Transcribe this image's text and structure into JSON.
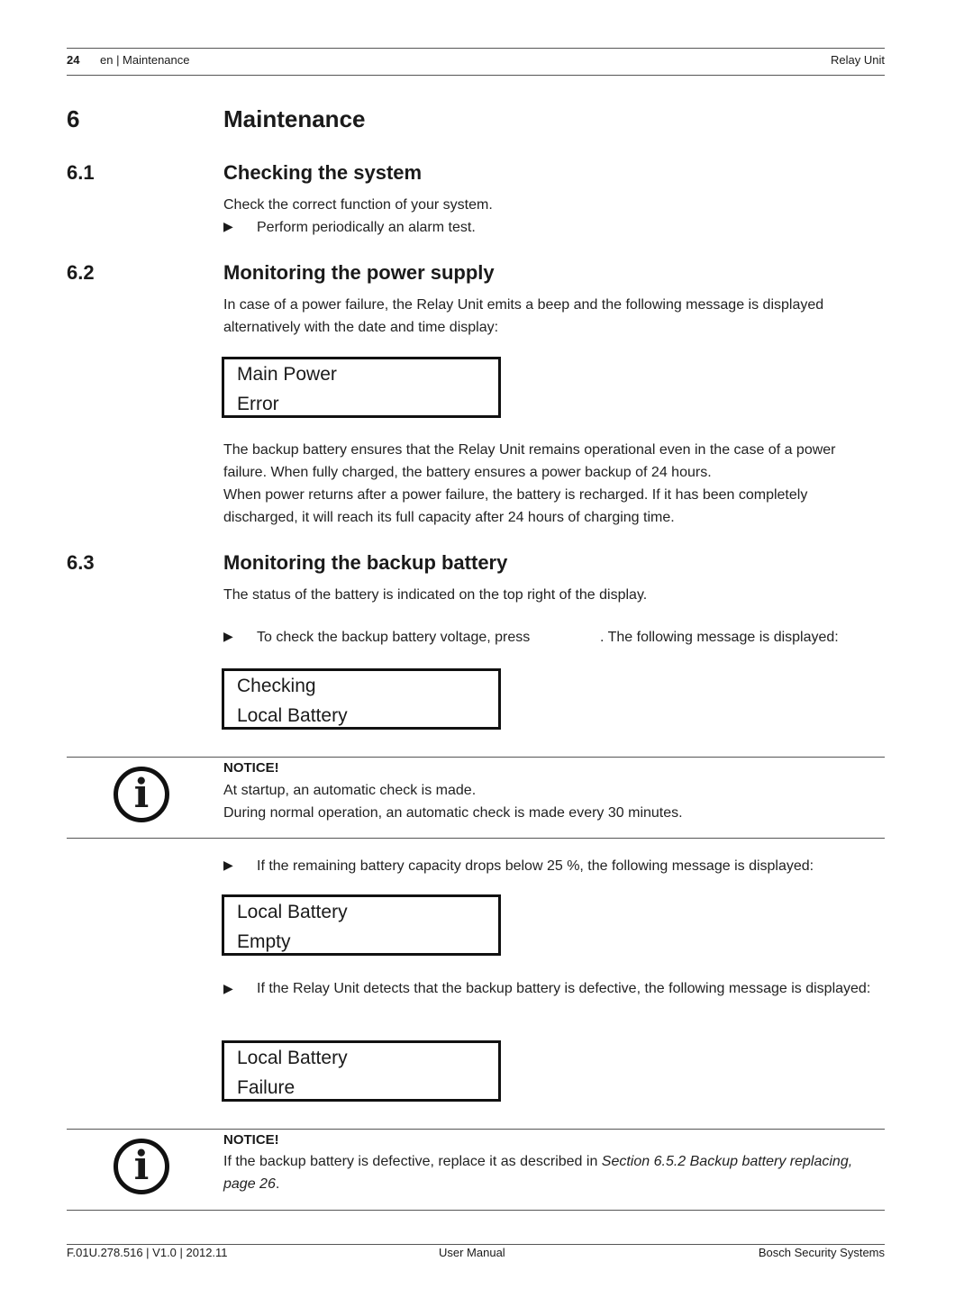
{
  "header": {
    "page_number": "24",
    "section_path": "en | Maintenance",
    "product": "Relay Unit"
  },
  "chapter": {
    "number": "6",
    "title": "Maintenance"
  },
  "sections": [
    {
      "number": "6.1",
      "title": "Checking the system",
      "paragraph": "Check the correct function of your system.",
      "bullet": "Perform periodically an alarm test."
    },
    {
      "number": "6.2",
      "title": "Monitoring the power supply",
      "paragraph_1": "In case of a power failure, the Relay Unit emits a beep and the following message is displayed alternatively with the date and time display:",
      "display": [
        "Main Power",
        "Error"
      ],
      "paragraph_2a": "The backup battery ensures that the Relay Unit remains operational even in the case of a power failure. When fully charged, the battery ensures a power backup of 24 hours.",
      "paragraph_2b": "When power returns after a power failure, the battery is recharged. If it has been completely discharged, it will reach its full capacity after 24 hours of charging time."
    },
    {
      "number": "6.3",
      "title": "Monitoring the backup battery",
      "paragraph": "The status of the battery is indicated on the top right of the display.",
      "bullet_1_before": "To check the backup battery voltage, press",
      "bullet_1_after": ". The following message is displayed:",
      "display_1": [
        "Checking",
        "Local Battery"
      ],
      "notice_1": {
        "title": "NOTICE!",
        "lines": [
          "At startup, an automatic check is made.",
          "During normal operation, an automatic check is made every 30 minutes."
        ]
      },
      "bullet_2": "If the remaining battery capacity drops below 25 %, the following message is displayed:",
      "display_2": [
        "Local Battery",
        "Empty"
      ],
      "bullet_3": "If the Relay Unit detects that the backup battery is defective, the following message is displayed:",
      "display_3": [
        "Local Battery",
        "Failure"
      ],
      "notice_2": {
        "title": "NOTICE!",
        "text_before": "If the backup battery is defective, replace it as described in ",
        "link_text": "Section 6.5.2 Backup battery replacing, page 26",
        "text_after": "."
      }
    }
  ],
  "icons": {
    "bullet": "triangle-right-icon",
    "notice": "info-icon"
  },
  "footer": {
    "doc_id": "F.01U.278.516 | V1.0 | 2012.11",
    "doc_type": "User Manual",
    "company": "Bosch Security Systems"
  }
}
